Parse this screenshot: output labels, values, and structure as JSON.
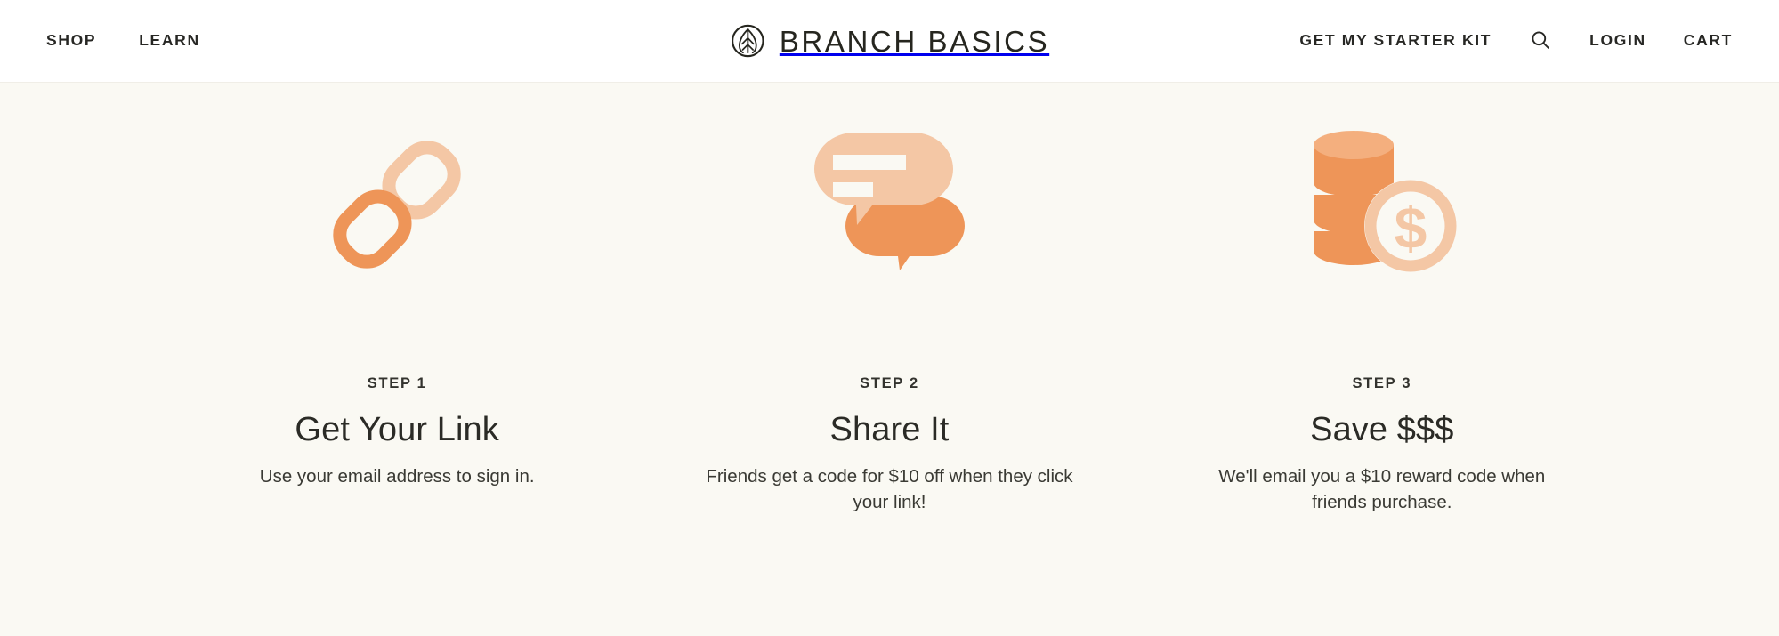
{
  "header": {
    "nav_left": [
      {
        "label": "SHOP",
        "name": "nav-link-shop"
      },
      {
        "label": "LEARN",
        "name": "nav-link-learn"
      }
    ],
    "brand": {
      "name": "BRANCH BASICS",
      "mark_icon": "leaf-in-circle-icon"
    },
    "nav_right": [
      {
        "label": "GET MY STARTER KIT",
        "name": "nav-link-get-my-starter-kit"
      },
      {
        "label": "LOGIN",
        "name": "nav-link-login"
      },
      {
        "label": "CART",
        "name": "nav-link-cart"
      }
    ],
    "search_icon": "search-icon",
    "background": "#FFFFFF",
    "text_color": "#272724"
  },
  "steps_section": {
    "background": "#FAF9F3",
    "accent_light": "#F4C7A5",
    "accent_dark": "#EE9558",
    "steps": [
      {
        "eyebrow": "STEP 1",
        "title": "Get Your Link",
        "description": "Use your email address to sign in.",
        "icon": "chain-link-icon"
      },
      {
        "eyebrow": "STEP 2",
        "title": "Share It",
        "description": "Friends get a code for $10 off when they click your link!",
        "icon": "speech-bubbles-icon"
      },
      {
        "eyebrow": "STEP 3",
        "title": "Save $$$",
        "description": "We'll email you a $10 reward code when friends purchase.",
        "icon": "coins-dollar-icon"
      }
    ]
  }
}
